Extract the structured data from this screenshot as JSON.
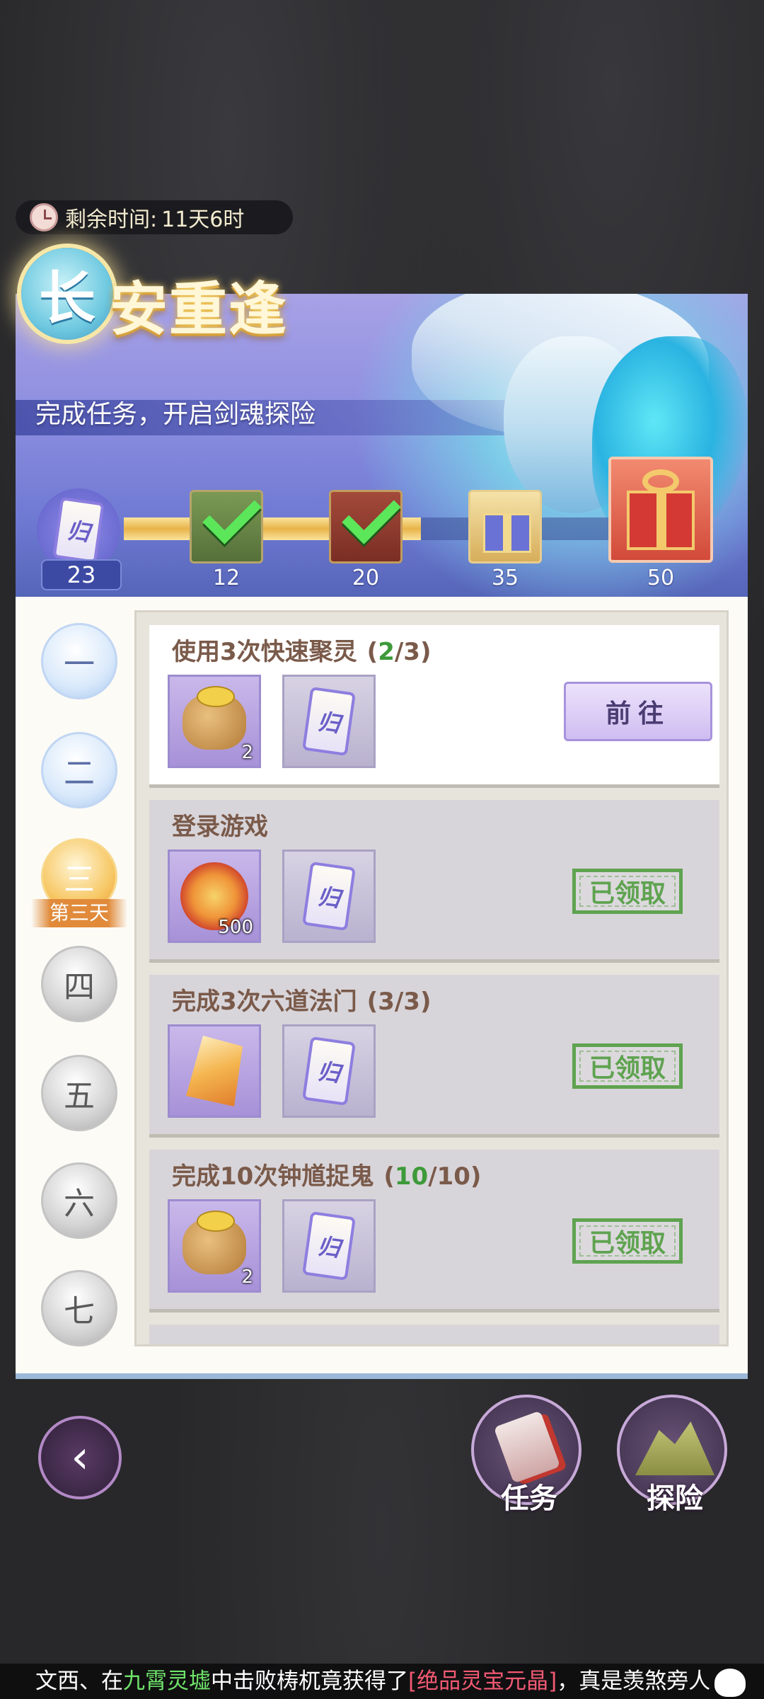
{
  "timer": {
    "label": "剩余时间:",
    "value": "11天6时"
  },
  "banner": {
    "title_first": "长",
    "title_rest": "安重逢",
    "subtitle": "完成任务，开启剑魂探险",
    "current_points": "23",
    "token_icon_text": "归",
    "milestones": [
      {
        "points": "12",
        "icon": "treasure-chest-icon",
        "claimed": true
      },
      {
        "points": "20",
        "icon": "gift-box-icon",
        "claimed": true
      },
      {
        "points": "35",
        "icon": "gift-box-icon",
        "claimed": false
      },
      {
        "points": "50",
        "icon": "big-gift-icon",
        "claimed": false
      }
    ]
  },
  "days": [
    {
      "label": "一",
      "state": "completed"
    },
    {
      "label": "二",
      "state": "completed"
    },
    {
      "label": "三",
      "state": "current",
      "tag": "第三天"
    },
    {
      "label": "四",
      "state": "locked"
    },
    {
      "label": "五",
      "state": "locked"
    },
    {
      "label": "六",
      "state": "locked"
    },
    {
      "label": "七",
      "state": "locked"
    }
  ],
  "tasks": [
    {
      "title": "使用3次快速聚灵",
      "progress_open": "(",
      "progress_done": "2",
      "progress_rest": "/3)",
      "reward1_qty": "2",
      "reward2_text": "归",
      "action": "前往",
      "status": "incomplete"
    },
    {
      "title": "登录游戏",
      "reward1_qty": "500",
      "reward2_text": "归",
      "action": "已领取",
      "status": "claimed"
    },
    {
      "title": "完成3次六道法门",
      "progress_open": "(",
      "progress_done": "3",
      "progress_rest": "/3)",
      "reward1_qty": "",
      "reward2_text": "归",
      "action": "已领取",
      "status": "claimed"
    },
    {
      "title": "完成10次钟馗捉鬼",
      "progress_open": "(",
      "progress_done": "10",
      "progress_rest": "/10)",
      "reward1_qty": "2",
      "reward2_text": "归",
      "action": "已领取",
      "status": "claimed"
    }
  ],
  "bottom": {
    "back_glyph": "‹",
    "tasks_label": "任务",
    "explore_label": "探险"
  },
  "ticker": {
    "player": "文西、在",
    "place": "九霄灵墟",
    "middle": "中击败梼杌竟获得了",
    "item": "[绝品灵宝元晶]",
    "end": "，真是羡煞旁人"
  },
  "colors": {
    "accent_green": "#5fa350",
    "progress_gold": "#e8b44b",
    "title_brown": "#7a5a4a"
  }
}
